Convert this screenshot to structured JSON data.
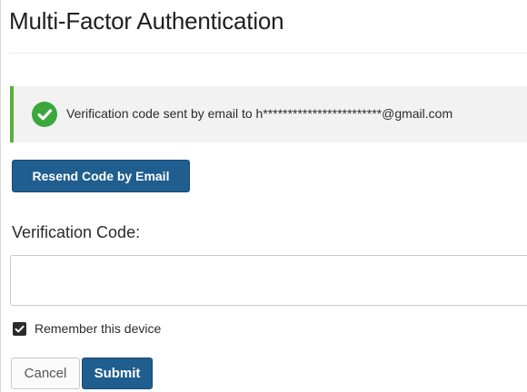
{
  "page": {
    "title": "Multi-Factor Authentication"
  },
  "alert": {
    "message": "Verification code sent by email to h************************@gmail.com",
    "icon": "check-circle-icon",
    "accent_color": "#58b038"
  },
  "actions": {
    "resend_label": "Resend Code by Email",
    "cancel_label": "Cancel",
    "submit_label": "Submit",
    "primary_color": "#1f5e8f"
  },
  "form": {
    "code_label": "Verification Code:",
    "code_value": "",
    "remember_label": "Remember this device",
    "remember_checked": true
  }
}
